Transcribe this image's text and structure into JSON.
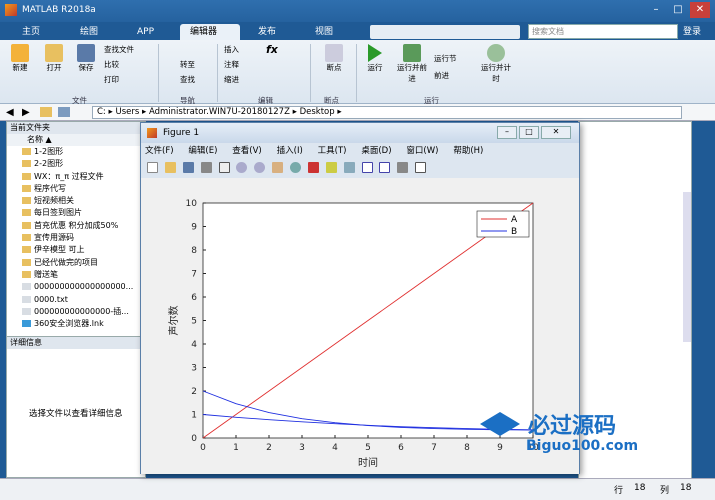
{
  "app": {
    "title": "MATLAB R2018a"
  },
  "tabs": [
    "主页",
    "绘图",
    "APP",
    "编辑器",
    "发布",
    "视图"
  ],
  "active_tab": "编辑器",
  "search": {
    "placeholder": "搜索文档"
  },
  "login": "登录",
  "ribbon": {
    "file": {
      "new": "新建",
      "open": "打开",
      "save": "保存",
      "find_files": "查找文件",
      "compare": "比较",
      "print": "打印",
      "label": "文件"
    },
    "nav": {
      "goto": "转至",
      "find": "查找",
      "label": "导航"
    },
    "edit": {
      "insert": "插入",
      "comment": "注释",
      "indent": "缩进",
      "fx": "fx",
      "label": "编辑"
    },
    "breakpoint": {
      "label": "断点",
      "btn": "断点"
    },
    "run": {
      "run": "运行",
      "run_advance": "运行并前进",
      "run_section": "运行节",
      "advance": "前进",
      "run_time": "运行并计时",
      "label": "运行"
    }
  },
  "address": {
    "path": [
      "C:",
      "Users",
      "Administrator.WIN7U-20180127Z",
      "Desktop"
    ]
  },
  "current_folder": {
    "title": "当前文件夹",
    "col_name": "名称 ▲",
    "files": [
      "1-2图形",
      "2-2图形",
      "WX：π_π 过程文件",
      "程序代写",
      "短视频相关",
      "每日签到图片",
      "首充优惠 积分加成50%",
      "宣传用源码",
      "伊辛模型 可上",
      "已经代做完的项目",
      "赠送笔",
      "000000000000000000...",
      "0000.txt",
      "000000000000000-插...",
      "360安全浏览器.lnk"
    ]
  },
  "details": {
    "title": "详细信息",
    "msg": "选择文件以查看详细信息"
  },
  "status": {
    "row_label": "行",
    "row": "18",
    "col_label": "列",
    "col": "18"
  },
  "figure": {
    "title": "Figure 1",
    "menu": [
      "文件(F)",
      "编辑(E)",
      "查看(V)",
      "插入(I)",
      "工具(T)",
      "桌面(D)",
      "窗口(W)",
      "帮助(H)"
    ]
  },
  "watermark": {
    "cn": "必过源码",
    "url": "Biguo100.com"
  },
  "colors": {
    "series_a": "#e03030",
    "series_b": "#2030e0",
    "matlab_blue": "#1f5a95"
  },
  "chart_data": {
    "type": "line",
    "xlabel": "时间",
    "ylabel": "声尔数",
    "xlim": [
      0,
      10
    ],
    "ylim": [
      0,
      10
    ],
    "xticks": [
      0,
      1,
      2,
      3,
      4,
      5,
      6,
      7,
      8,
      9,
      10
    ],
    "yticks": [
      0,
      1,
      2,
      3,
      4,
      5,
      6,
      7,
      8,
      9,
      10
    ],
    "legend_position": "top-right",
    "series": [
      {
        "name": "A",
        "x": [
          0,
          1,
          2,
          3,
          4,
          5,
          6,
          7,
          8,
          9,
          10
        ],
        "y": [
          0,
          1,
          2,
          3,
          4,
          5,
          6,
          7,
          8,
          9,
          10
        ]
      },
      {
        "name": "B",
        "x": [
          0,
          1,
          2,
          3,
          4,
          5,
          6,
          7,
          8,
          9,
          10
        ],
        "y": [
          2.0,
          1.46,
          1.08,
          0.82,
          0.65,
          0.53,
          0.45,
          0.4,
          0.37,
          0.35,
          0.34
        ]
      },
      {
        "name": "",
        "x": [
          0,
          1,
          2,
          3,
          4,
          5,
          6,
          7,
          8,
          9,
          10
        ],
        "y": [
          1.0,
          0.88,
          0.78,
          0.69,
          0.61,
          0.54,
          0.48,
          0.44,
          0.4,
          0.37,
          0.35
        ]
      }
    ]
  }
}
